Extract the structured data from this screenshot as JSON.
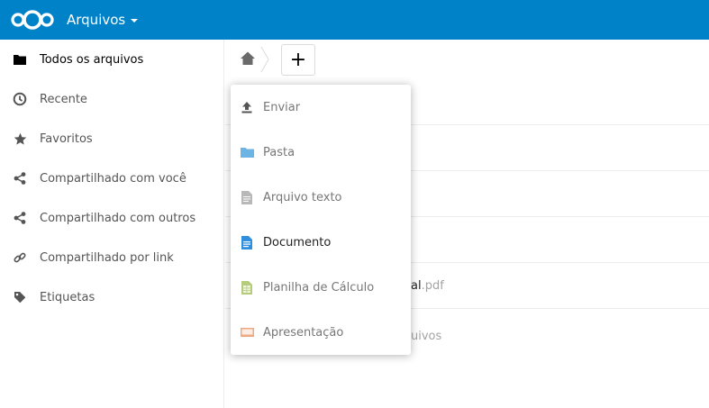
{
  "header": {
    "app_name": "Arquivos"
  },
  "sidebar": {
    "items": [
      {
        "label": "Todos os arquivos",
        "icon": "folder-icon"
      },
      {
        "label": "Recente",
        "icon": "clock-icon"
      },
      {
        "label": "Favoritos",
        "icon": "star-icon"
      },
      {
        "label": "Compartilhado com você",
        "icon": "share-icon"
      },
      {
        "label": "Compartilhado com outros",
        "icon": "share-icon"
      },
      {
        "label": "Compartilhado por link",
        "icon": "link-icon"
      },
      {
        "label": "Etiquetas",
        "icon": "tag-icon"
      }
    ]
  },
  "breadcrumb": {
    "new_label": "+"
  },
  "file_list": {
    "partial_name": "al",
    "partial_ext": ".pdf",
    "partial_folder": "uivos"
  },
  "new_menu": {
    "items": [
      {
        "label": "Enviar",
        "icon": "upload-icon"
      },
      {
        "label": "Pasta",
        "icon": "folder-icon",
        "color": "#6cb4e3"
      },
      {
        "label": "Arquivo texto",
        "icon": "text-file-icon",
        "color": "#b8b8b8"
      },
      {
        "label": "Documento",
        "icon": "document-icon",
        "color": "#2f8ede"
      },
      {
        "label": "Planilha de Cálculo",
        "icon": "spreadsheet-icon",
        "color": "#b6cc7d"
      },
      {
        "label": "Apresentação",
        "icon": "presentation-icon",
        "color": "#f0a881"
      }
    ]
  },
  "colors": {
    "header_bg": "#0082c9"
  }
}
